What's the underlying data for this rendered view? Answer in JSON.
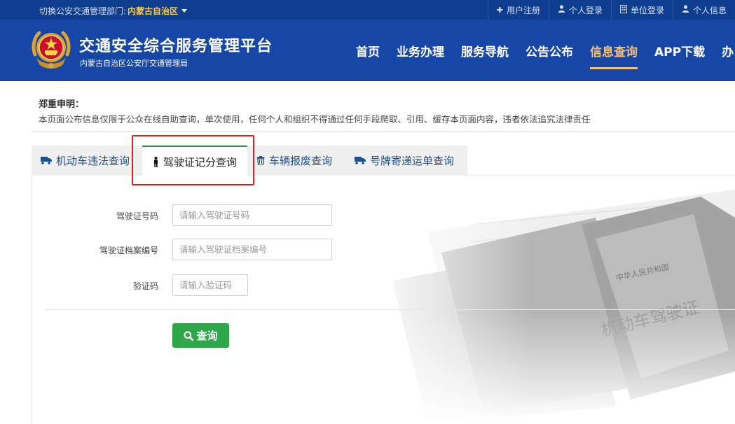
{
  "topbar": {
    "switch_label": "切换公安交通管理部门:",
    "region": "内蒙古自治区",
    "links": [
      {
        "label": "用户注册",
        "icon": "plus-icon"
      },
      {
        "label": "个人登录",
        "icon": "user-icon"
      },
      {
        "label": "单位登录",
        "icon": "building-icon"
      },
      {
        "label": "个人信息",
        "icon": "user-icon"
      }
    ]
  },
  "header": {
    "title": "交通安全综合服务管理平台",
    "subtitle": "内蒙古自治区公安厅交通管理局",
    "logo_icon": "police-emblem-icon",
    "nav": [
      {
        "label": "首页",
        "active": false
      },
      {
        "label": "业务办理",
        "active": false
      },
      {
        "label": "服务导航",
        "active": false
      },
      {
        "label": "公告公布",
        "active": false
      },
      {
        "label": "信息查询",
        "active": true
      },
      {
        "label": "APP下载",
        "active": false
      },
      {
        "label": "办",
        "active": false
      }
    ],
    "accent_color": "#f2c079",
    "bg_color": "#1646a6"
  },
  "notice": {
    "title": "郑重申明：",
    "text": "本页面公布信息仅限于公众在线自助查询，单次使用，任何个人和组织不得通过任何手段爬取、引用、缓存本页面内容，违者依法追究法律责任"
  },
  "tabs": [
    {
      "label": "机动车违法查询",
      "icon": "truck-icon",
      "active": false
    },
    {
      "label": "驾驶证记分查询",
      "icon": "person-icon",
      "active": true
    },
    {
      "label": "车辆报废查询",
      "icon": "trash-icon",
      "active": false
    },
    {
      "label": "号牌寄递运单查询",
      "icon": "truck-icon",
      "active": false
    }
  ],
  "form": {
    "license_no": {
      "label": "驾驶证号码",
      "placeholder": "请输入驾驶证号码",
      "value": ""
    },
    "file_no": {
      "label": "驾驶证档案编号",
      "placeholder": "请输入驾驶证档案编号",
      "value": ""
    },
    "captcha": {
      "label": "验证码",
      "placeholder": "请输入验证码",
      "value": ""
    },
    "submit_label": "查询",
    "submit_icon": "search-icon",
    "submit_color": "#2ea64a"
  },
  "highlight_color": "#e02020"
}
